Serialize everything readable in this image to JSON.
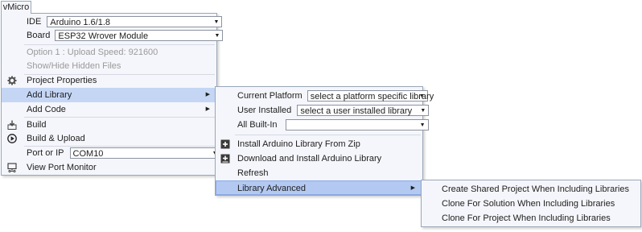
{
  "menu_tab": "vMicro",
  "main_menu": {
    "ide": {
      "label": "IDE",
      "value": "Arduino 1.6/1.8"
    },
    "board": {
      "label": "Board",
      "value": "ESP32 Wrover Module"
    },
    "option": "Option 1 : Upload Speed: 921600",
    "show_hide": "Show/Hide Hidden Files",
    "project_properties": "Project Properties",
    "add_library": "Add Library",
    "add_code": "Add Code",
    "build": "Build",
    "build_upload": "Build & Upload",
    "port": {
      "label": "Port or IP",
      "value": "COM10"
    },
    "view_port_monitor": "View Port Monitor"
  },
  "library_menu": {
    "current_platform": {
      "label": "Current Platform",
      "value": "select a platform specific library"
    },
    "user_installed": {
      "label": "User Installed",
      "value": "select a user installed library"
    },
    "all_builtin": {
      "label": "All Built-In",
      "value": ""
    },
    "install_zip": "Install Arduino Library From Zip",
    "download_install": "Download and Install Arduino Library",
    "refresh": "Refresh",
    "library_advanced": "Library Advanced"
  },
  "advanced_menu": {
    "items": [
      "Create Shared Project When Including Libraries",
      "Clone For Solution When Including Libraries",
      "Clone For Project When Including Libraries"
    ]
  },
  "icons": {
    "arrow": "▶",
    "dropdown": "▼"
  }
}
